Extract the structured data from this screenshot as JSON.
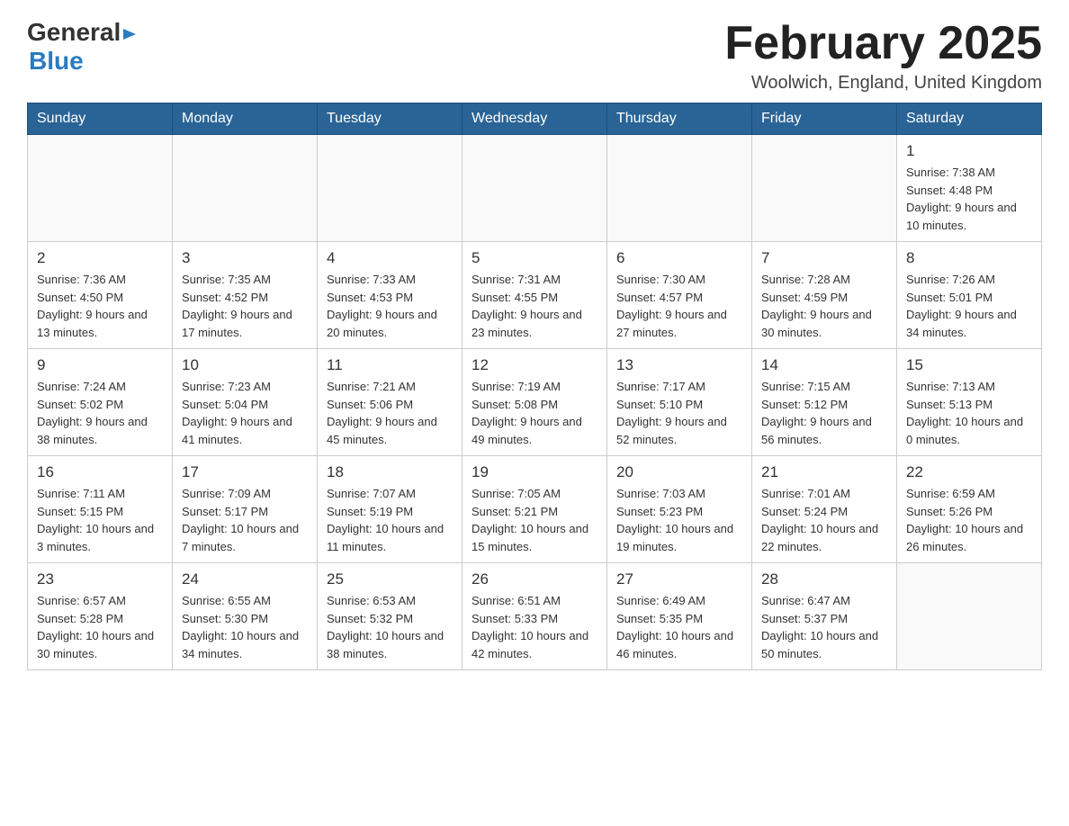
{
  "header": {
    "logo_general": "General",
    "logo_blue": "Blue",
    "title": "February 2025",
    "location": "Woolwich, England, United Kingdom"
  },
  "days_of_week": [
    "Sunday",
    "Monday",
    "Tuesday",
    "Wednesday",
    "Thursday",
    "Friday",
    "Saturday"
  ],
  "weeks": [
    {
      "days": [
        {
          "date": "",
          "info": ""
        },
        {
          "date": "",
          "info": ""
        },
        {
          "date": "",
          "info": ""
        },
        {
          "date": "",
          "info": ""
        },
        {
          "date": "",
          "info": ""
        },
        {
          "date": "",
          "info": ""
        },
        {
          "date": "1",
          "info": "Sunrise: 7:38 AM\nSunset: 4:48 PM\nDaylight: 9 hours and 10 minutes."
        }
      ]
    },
    {
      "days": [
        {
          "date": "2",
          "info": "Sunrise: 7:36 AM\nSunset: 4:50 PM\nDaylight: 9 hours and 13 minutes."
        },
        {
          "date": "3",
          "info": "Sunrise: 7:35 AM\nSunset: 4:52 PM\nDaylight: 9 hours and 17 minutes."
        },
        {
          "date": "4",
          "info": "Sunrise: 7:33 AM\nSunset: 4:53 PM\nDaylight: 9 hours and 20 minutes."
        },
        {
          "date": "5",
          "info": "Sunrise: 7:31 AM\nSunset: 4:55 PM\nDaylight: 9 hours and 23 minutes."
        },
        {
          "date": "6",
          "info": "Sunrise: 7:30 AM\nSunset: 4:57 PM\nDaylight: 9 hours and 27 minutes."
        },
        {
          "date": "7",
          "info": "Sunrise: 7:28 AM\nSunset: 4:59 PM\nDaylight: 9 hours and 30 minutes."
        },
        {
          "date": "8",
          "info": "Sunrise: 7:26 AM\nSunset: 5:01 PM\nDaylight: 9 hours and 34 minutes."
        }
      ]
    },
    {
      "days": [
        {
          "date": "9",
          "info": "Sunrise: 7:24 AM\nSunset: 5:02 PM\nDaylight: 9 hours and 38 minutes."
        },
        {
          "date": "10",
          "info": "Sunrise: 7:23 AM\nSunset: 5:04 PM\nDaylight: 9 hours and 41 minutes."
        },
        {
          "date": "11",
          "info": "Sunrise: 7:21 AM\nSunset: 5:06 PM\nDaylight: 9 hours and 45 minutes."
        },
        {
          "date": "12",
          "info": "Sunrise: 7:19 AM\nSunset: 5:08 PM\nDaylight: 9 hours and 49 minutes."
        },
        {
          "date": "13",
          "info": "Sunrise: 7:17 AM\nSunset: 5:10 PM\nDaylight: 9 hours and 52 minutes."
        },
        {
          "date": "14",
          "info": "Sunrise: 7:15 AM\nSunset: 5:12 PM\nDaylight: 9 hours and 56 minutes."
        },
        {
          "date": "15",
          "info": "Sunrise: 7:13 AM\nSunset: 5:13 PM\nDaylight: 10 hours and 0 minutes."
        }
      ]
    },
    {
      "days": [
        {
          "date": "16",
          "info": "Sunrise: 7:11 AM\nSunset: 5:15 PM\nDaylight: 10 hours and 3 minutes."
        },
        {
          "date": "17",
          "info": "Sunrise: 7:09 AM\nSunset: 5:17 PM\nDaylight: 10 hours and 7 minutes."
        },
        {
          "date": "18",
          "info": "Sunrise: 7:07 AM\nSunset: 5:19 PM\nDaylight: 10 hours and 11 minutes."
        },
        {
          "date": "19",
          "info": "Sunrise: 7:05 AM\nSunset: 5:21 PM\nDaylight: 10 hours and 15 minutes."
        },
        {
          "date": "20",
          "info": "Sunrise: 7:03 AM\nSunset: 5:23 PM\nDaylight: 10 hours and 19 minutes."
        },
        {
          "date": "21",
          "info": "Sunrise: 7:01 AM\nSunset: 5:24 PM\nDaylight: 10 hours and 22 minutes."
        },
        {
          "date": "22",
          "info": "Sunrise: 6:59 AM\nSunset: 5:26 PM\nDaylight: 10 hours and 26 minutes."
        }
      ]
    },
    {
      "days": [
        {
          "date": "23",
          "info": "Sunrise: 6:57 AM\nSunset: 5:28 PM\nDaylight: 10 hours and 30 minutes."
        },
        {
          "date": "24",
          "info": "Sunrise: 6:55 AM\nSunset: 5:30 PM\nDaylight: 10 hours and 34 minutes."
        },
        {
          "date": "25",
          "info": "Sunrise: 6:53 AM\nSunset: 5:32 PM\nDaylight: 10 hours and 38 minutes."
        },
        {
          "date": "26",
          "info": "Sunrise: 6:51 AM\nSunset: 5:33 PM\nDaylight: 10 hours and 42 minutes."
        },
        {
          "date": "27",
          "info": "Sunrise: 6:49 AM\nSunset: 5:35 PM\nDaylight: 10 hours and 46 minutes."
        },
        {
          "date": "28",
          "info": "Sunrise: 6:47 AM\nSunset: 5:37 PM\nDaylight: 10 hours and 50 minutes."
        },
        {
          "date": "",
          "info": ""
        }
      ]
    }
  ]
}
